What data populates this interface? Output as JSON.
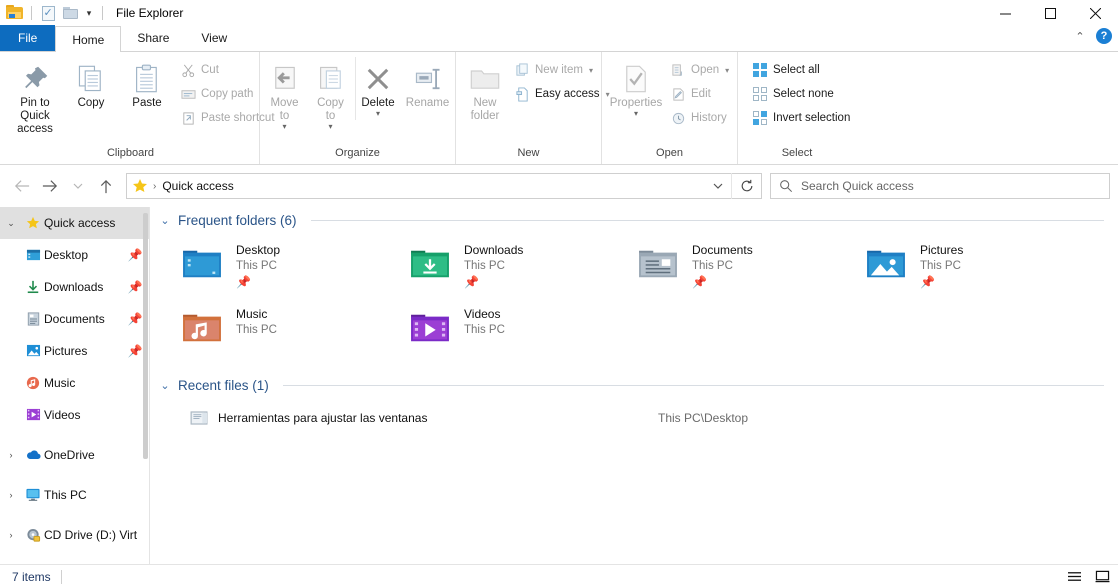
{
  "window": {
    "title": "File Explorer",
    "app_icon": "folder-icon",
    "quick_access_toolbar": [
      {
        "name": "properties-icon",
        "label": "Properties"
      },
      {
        "name": "new-folder-icon",
        "label": "New folder"
      },
      {
        "name": "customize-qat-caret",
        "label": "Customize Quick Access Toolbar"
      }
    ],
    "controls": {
      "minimize": "Minimize",
      "maximize": "Maximize",
      "close": "Close"
    }
  },
  "tabs": [
    {
      "label": "File",
      "state": "menu"
    },
    {
      "label": "Home",
      "state": "active"
    },
    {
      "label": "Share",
      "state": "normal"
    },
    {
      "label": "View",
      "state": "normal"
    }
  ],
  "ribbon": {
    "collapse_label": "Minimize the Ribbon",
    "help_label": "?",
    "groups": [
      {
        "title": "Clipboard",
        "big": [
          {
            "label": "Pin to Quick\naccess",
            "line1": "Pin to Quick",
            "line2": "access",
            "icon": "pin-icon",
            "disabled": false
          },
          {
            "label": "Copy",
            "line1": "Copy",
            "line2": "",
            "icon": "copy-icon",
            "disabled": false
          },
          {
            "label": "Paste",
            "line1": "Paste",
            "line2": "",
            "icon": "paste-icon",
            "disabled": false
          }
        ],
        "small": [
          {
            "label": "Cut",
            "icon": "scissors-icon",
            "disabled": true
          },
          {
            "label": "Copy path",
            "icon": "copy-path-icon",
            "disabled": true
          },
          {
            "label": "Paste shortcut",
            "icon": "paste-shortcut-icon",
            "disabled": true
          }
        ]
      },
      {
        "title": "Organize",
        "big": [
          {
            "line1": "Move",
            "line2": "to",
            "icon": "move-to-icon",
            "disabled": true,
            "caret": true
          },
          {
            "line1": "Copy",
            "line2": "to",
            "icon": "copy-to-icon",
            "disabled": true,
            "caret": true
          },
          {
            "line1": "Delete",
            "line2": "",
            "icon": "delete-icon",
            "disabled": false,
            "caret": true
          },
          {
            "line1": "Rename",
            "line2": "",
            "icon": "rename-icon",
            "disabled": true
          }
        ],
        "small": []
      },
      {
        "title": "New",
        "big": [
          {
            "line1": "New",
            "line2": "folder",
            "icon": "new-folder-icon",
            "disabled": true
          }
        ],
        "small": [
          {
            "label": "New item",
            "icon": "new-item-icon",
            "disabled": true,
            "caret": true
          },
          {
            "label": "Easy access",
            "icon": "easy-access-icon",
            "disabled": false,
            "caret": true
          }
        ]
      },
      {
        "title": "Open",
        "big": [
          {
            "line1": "Properties",
            "line2": "",
            "icon": "properties-icon",
            "disabled": true,
            "caret": true
          }
        ],
        "small": [
          {
            "label": "Open",
            "icon": "open-icon",
            "disabled": true,
            "caret": true
          },
          {
            "label": "Edit",
            "icon": "edit-icon",
            "disabled": true
          },
          {
            "label": "History",
            "icon": "history-icon",
            "disabled": true
          }
        ]
      },
      {
        "title": "Select",
        "big": [],
        "small": [
          {
            "label": "Select all",
            "icon": "select-all-icon",
            "disabled": false
          },
          {
            "label": "Select none",
            "icon": "select-none-icon",
            "disabled": false
          },
          {
            "label": "Invert selection",
            "icon": "invert-selection-icon",
            "disabled": false
          }
        ]
      }
    ]
  },
  "addressbar": {
    "back": "Back",
    "forward": "Forward",
    "recent": "Recent locations",
    "up": "Up",
    "icon": "star-icon",
    "breadcrumb": "Quick access",
    "dropdown_caret": "Previous locations",
    "refresh": "Refresh",
    "search_placeholder": "Search Quick access",
    "search_value": ""
  },
  "sidebar": {
    "items": [
      {
        "label": "Quick access",
        "icon": "star-icon",
        "expander": "chevron-down",
        "selected": true,
        "indent": false,
        "pinned": false
      },
      {
        "label": "Desktop",
        "icon": "desktop-folder-icon",
        "expander": "",
        "selected": false,
        "indent": true,
        "pinned": true
      },
      {
        "label": "Downloads",
        "icon": "downloads-icon",
        "expander": "",
        "selected": false,
        "indent": true,
        "pinned": true
      },
      {
        "label": "Documents",
        "icon": "documents-icon",
        "expander": "",
        "selected": false,
        "indent": true,
        "pinned": true
      },
      {
        "label": "Pictures",
        "icon": "pictures-icon",
        "expander": "",
        "selected": false,
        "indent": true,
        "pinned": true
      },
      {
        "label": "Music",
        "icon": "music-icon",
        "expander": "",
        "selected": false,
        "indent": true,
        "pinned": false
      },
      {
        "label": "Videos",
        "icon": "videos-icon",
        "expander": "",
        "selected": false,
        "indent": true,
        "pinned": false
      },
      {
        "label": "OneDrive",
        "icon": "onedrive-icon",
        "expander": "chevron-right",
        "selected": false,
        "indent": false,
        "pinned": false
      },
      {
        "label": "This PC",
        "icon": "this-pc-icon",
        "expander": "chevron-right",
        "selected": false,
        "indent": false,
        "pinned": false
      },
      {
        "label": "CD Drive (D:) Virt",
        "icon": "cd-drive-icon",
        "expander": "chevron-right",
        "selected": false,
        "indent": false,
        "pinned": false
      }
    ]
  },
  "main": {
    "sections": [
      {
        "title": "Frequent folders (6)",
        "chevron": "chevron-down"
      },
      {
        "title": "Recent files (1)",
        "chevron": "chevron-down"
      }
    ],
    "frequent_folders": [
      {
        "name": "Desktop",
        "sub": "This PC",
        "icon": "desktop-folder-icon",
        "pinned": true
      },
      {
        "name": "Downloads",
        "sub": "This PC",
        "icon": "downloads-folder-icon",
        "pinned": true
      },
      {
        "name": "Documents",
        "sub": "This PC",
        "icon": "documents-folder-icon",
        "pinned": true
      },
      {
        "name": "Pictures",
        "sub": "This PC",
        "icon": "pictures-folder-icon",
        "pinned": true
      },
      {
        "name": "Music",
        "sub": "This PC",
        "icon": "music-folder-icon",
        "pinned": false
      },
      {
        "name": "Videos",
        "sub": "This PC",
        "icon": "videos-folder-icon",
        "pinned": false
      }
    ],
    "recent_files": [
      {
        "name": "Herramientas para ajustar las ventanas",
        "path": "This PC\\Desktop",
        "icon": "image-file-icon"
      }
    ]
  },
  "statusbar": {
    "items_text": "7 items",
    "views": [
      {
        "name": "details-view-button",
        "label": "Details view"
      },
      {
        "name": "large-icons-view-button",
        "label": "Large icons view"
      }
    ]
  },
  "colors": {
    "file_tab_blue": "#0d6cbf",
    "section_header_blue": "#2a5488",
    "status_text_blue": "#1f3864",
    "selection_gray": "#e0e0e0",
    "star_yellow": "#f5c518"
  }
}
